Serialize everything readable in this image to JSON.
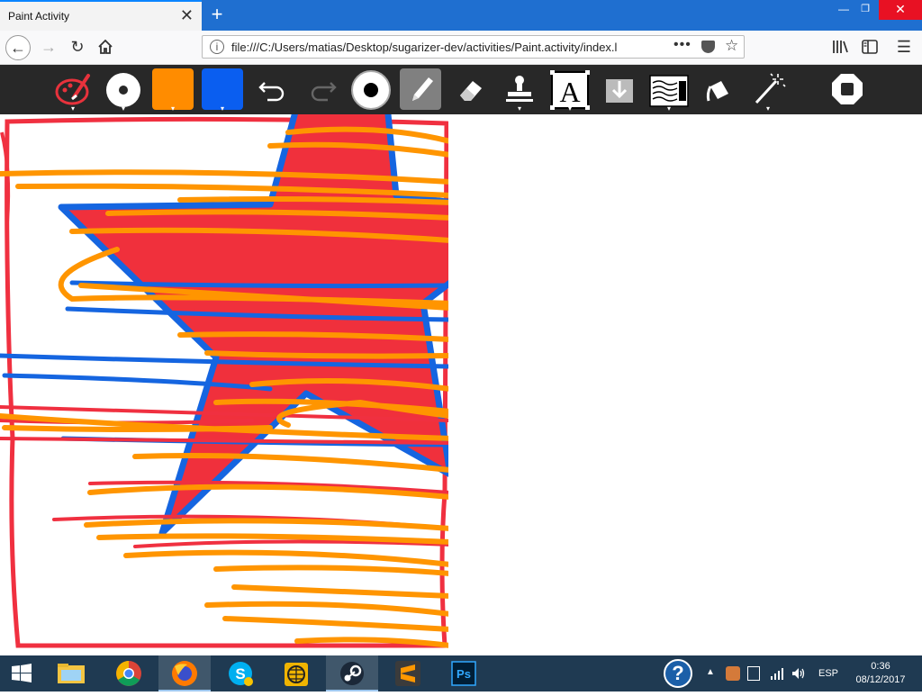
{
  "browser": {
    "tab_title": "Paint Activity",
    "tab_close": "✕",
    "new_tab": "+",
    "window_controls": {
      "minimize": "—",
      "maximize": "❐",
      "close": "✕"
    },
    "url": "file:///C:/Users/matias/Desktop/sugarizer-dev/activities/Paint.activity/index.l",
    "url_more": "•••"
  },
  "toolbar": {
    "tools": [
      {
        "name": "activity-icon",
        "has_menu": true
      },
      {
        "name": "brush-size-button",
        "has_menu": true
      },
      {
        "name": "fill-color-swatch",
        "color": "#ff8c00",
        "has_menu": true
      },
      {
        "name": "stroke-color-swatch",
        "color": "#0a5ef0",
        "has_menu": true
      },
      {
        "name": "undo-button",
        "has_menu": false
      },
      {
        "name": "redo-button",
        "has_menu": false
      },
      {
        "name": "size-indicator",
        "has_menu": false
      },
      {
        "name": "pen-tool",
        "selected": true,
        "has_menu": false
      },
      {
        "name": "eraser-tool",
        "has_menu": false
      },
      {
        "name": "stamp-tool",
        "has_menu": true
      },
      {
        "name": "text-tool",
        "label": "A",
        "has_menu": true
      },
      {
        "name": "insert-image-button",
        "has_menu": false
      },
      {
        "name": "filters-tool",
        "has_menu": true
      },
      {
        "name": "bucket-tool",
        "has_menu": false
      },
      {
        "name": "magic-wand-tool",
        "has_menu": true
      },
      {
        "name": "stop-button",
        "has_menu": false
      }
    ],
    "colors": {
      "background": "#282828",
      "fill": "#ff8c00",
      "stroke": "#0a5ef0",
      "brand_red": "#e8323c"
    }
  },
  "canvas": {
    "drawing_colors": {
      "star_fill": "#f0303c",
      "star_outline": "#1565e0",
      "scribble_orange": "#ff9500",
      "frame_red": "#f03040",
      "line_blue": "#1565e0"
    }
  },
  "taskbar": {
    "apps": [
      "file-explorer",
      "chrome",
      "firefox",
      "skype",
      "globe-app",
      "steam",
      "sublime-text",
      "photoshop"
    ],
    "active_app": "firefox",
    "language": "ESP",
    "time": "0:36",
    "date": "08/12/2017",
    "help_label": "?"
  }
}
